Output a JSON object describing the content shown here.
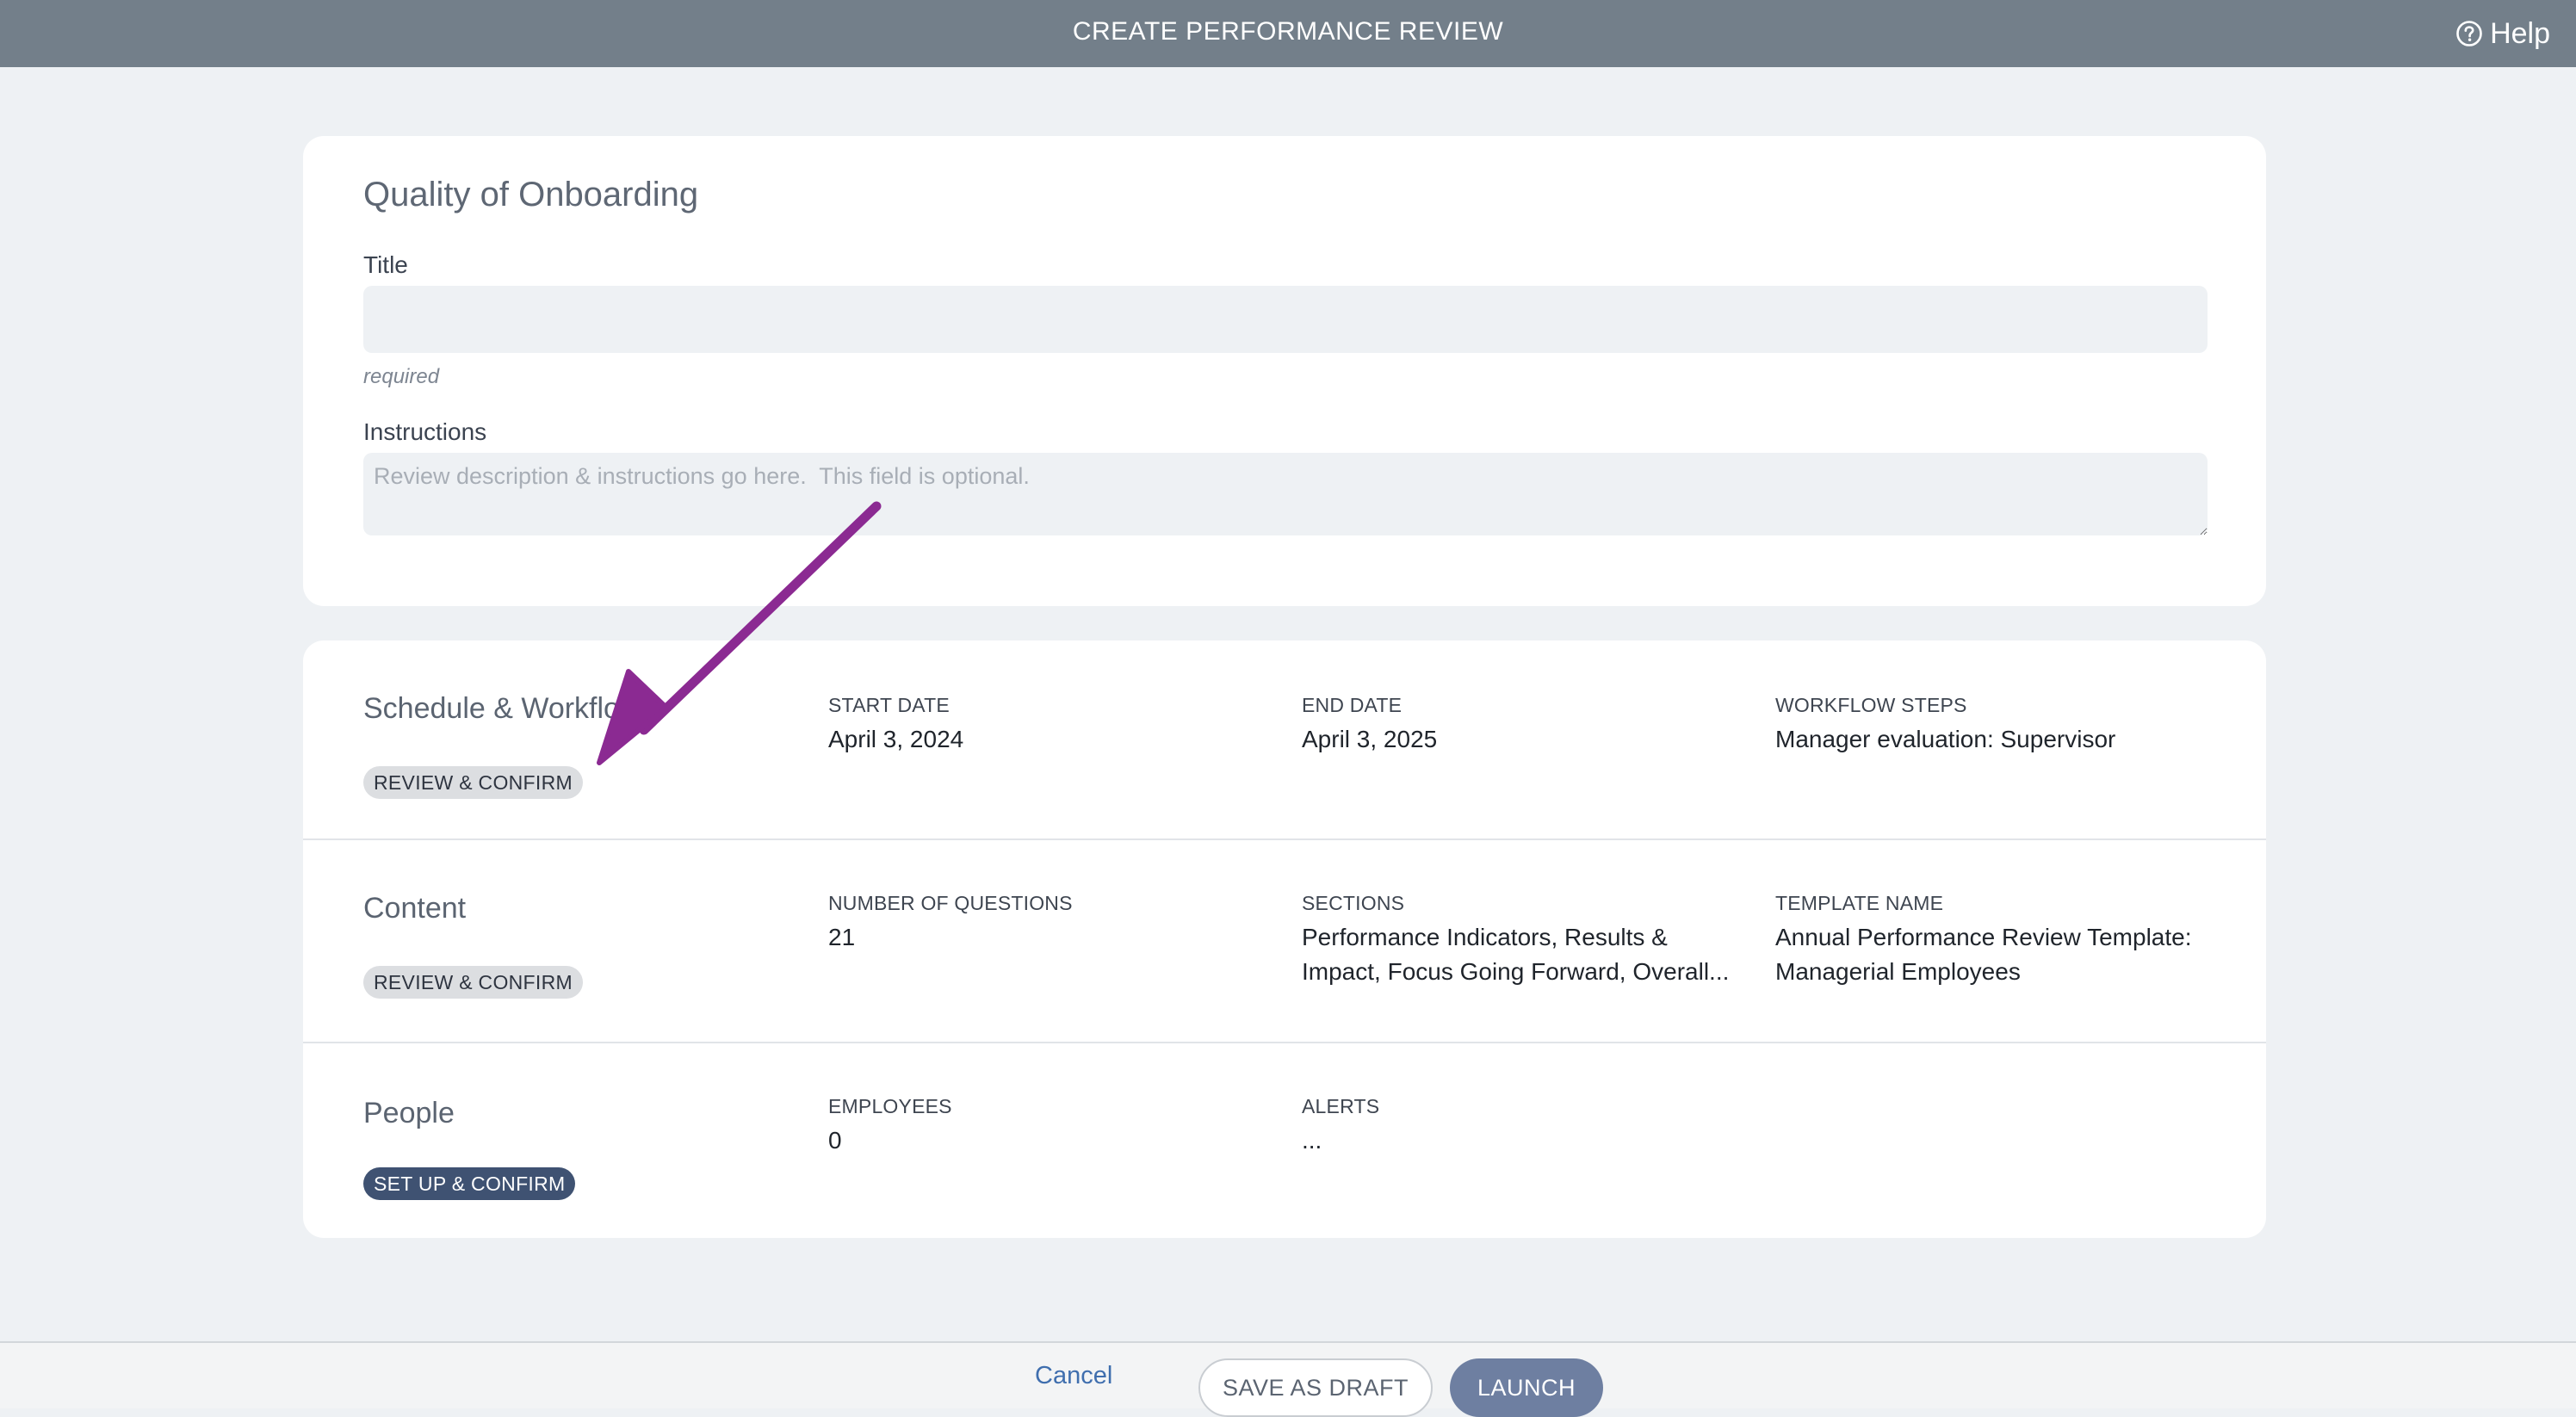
{
  "header": {
    "title": "CREATE PERFORMANCE REVIEW",
    "help_label": "Help",
    "help_icon": "question-circle-icon"
  },
  "review": {
    "name": "Quality of Onboarding",
    "title_label": "Title",
    "title_value": "",
    "title_hint": "required",
    "instructions_label": "Instructions",
    "instructions_value": "",
    "instructions_placeholder": "Review description & instructions go here.  This field is optional."
  },
  "sections": {
    "schedule": {
      "title": "Schedule & Workflow",
      "button": "REVIEW & CONFIRM",
      "fields": [
        {
          "label": "START DATE",
          "value": "April 3, 2024"
        },
        {
          "label": "END DATE",
          "value": "April 3, 2025"
        },
        {
          "label": "WORKFLOW STEPS",
          "value": "Manager evaluation: Supervisor"
        }
      ]
    },
    "content": {
      "title": "Content",
      "button": "REVIEW & CONFIRM",
      "fields": [
        {
          "label": "NUMBER OF QUESTIONS",
          "value": "21"
        },
        {
          "label": "SECTIONS",
          "value": "Performance Indicators, Results & Impact, Focus Going Forward, Overall..."
        },
        {
          "label": "TEMPLATE NAME",
          "value": "Annual Performance Review Template: Managerial Employees"
        }
      ]
    },
    "people": {
      "title": "People",
      "button": "SET UP & CONFIRM",
      "fields": [
        {
          "label": "EMPLOYEES",
          "value": "0"
        },
        {
          "label": "ALERTS",
          "value": "..."
        }
      ]
    }
  },
  "footer": {
    "cancel": "Cancel",
    "save_draft": "SAVE AS DRAFT",
    "launch": "LAUNCH"
  },
  "colors": {
    "topbar": "#737f8a",
    "page_background": "#eef1f4",
    "annotation_arrow": "#8b2a92",
    "pill_dark": "#3f5272",
    "launch_button": "#6e7fa1",
    "link": "#3f6eae"
  }
}
